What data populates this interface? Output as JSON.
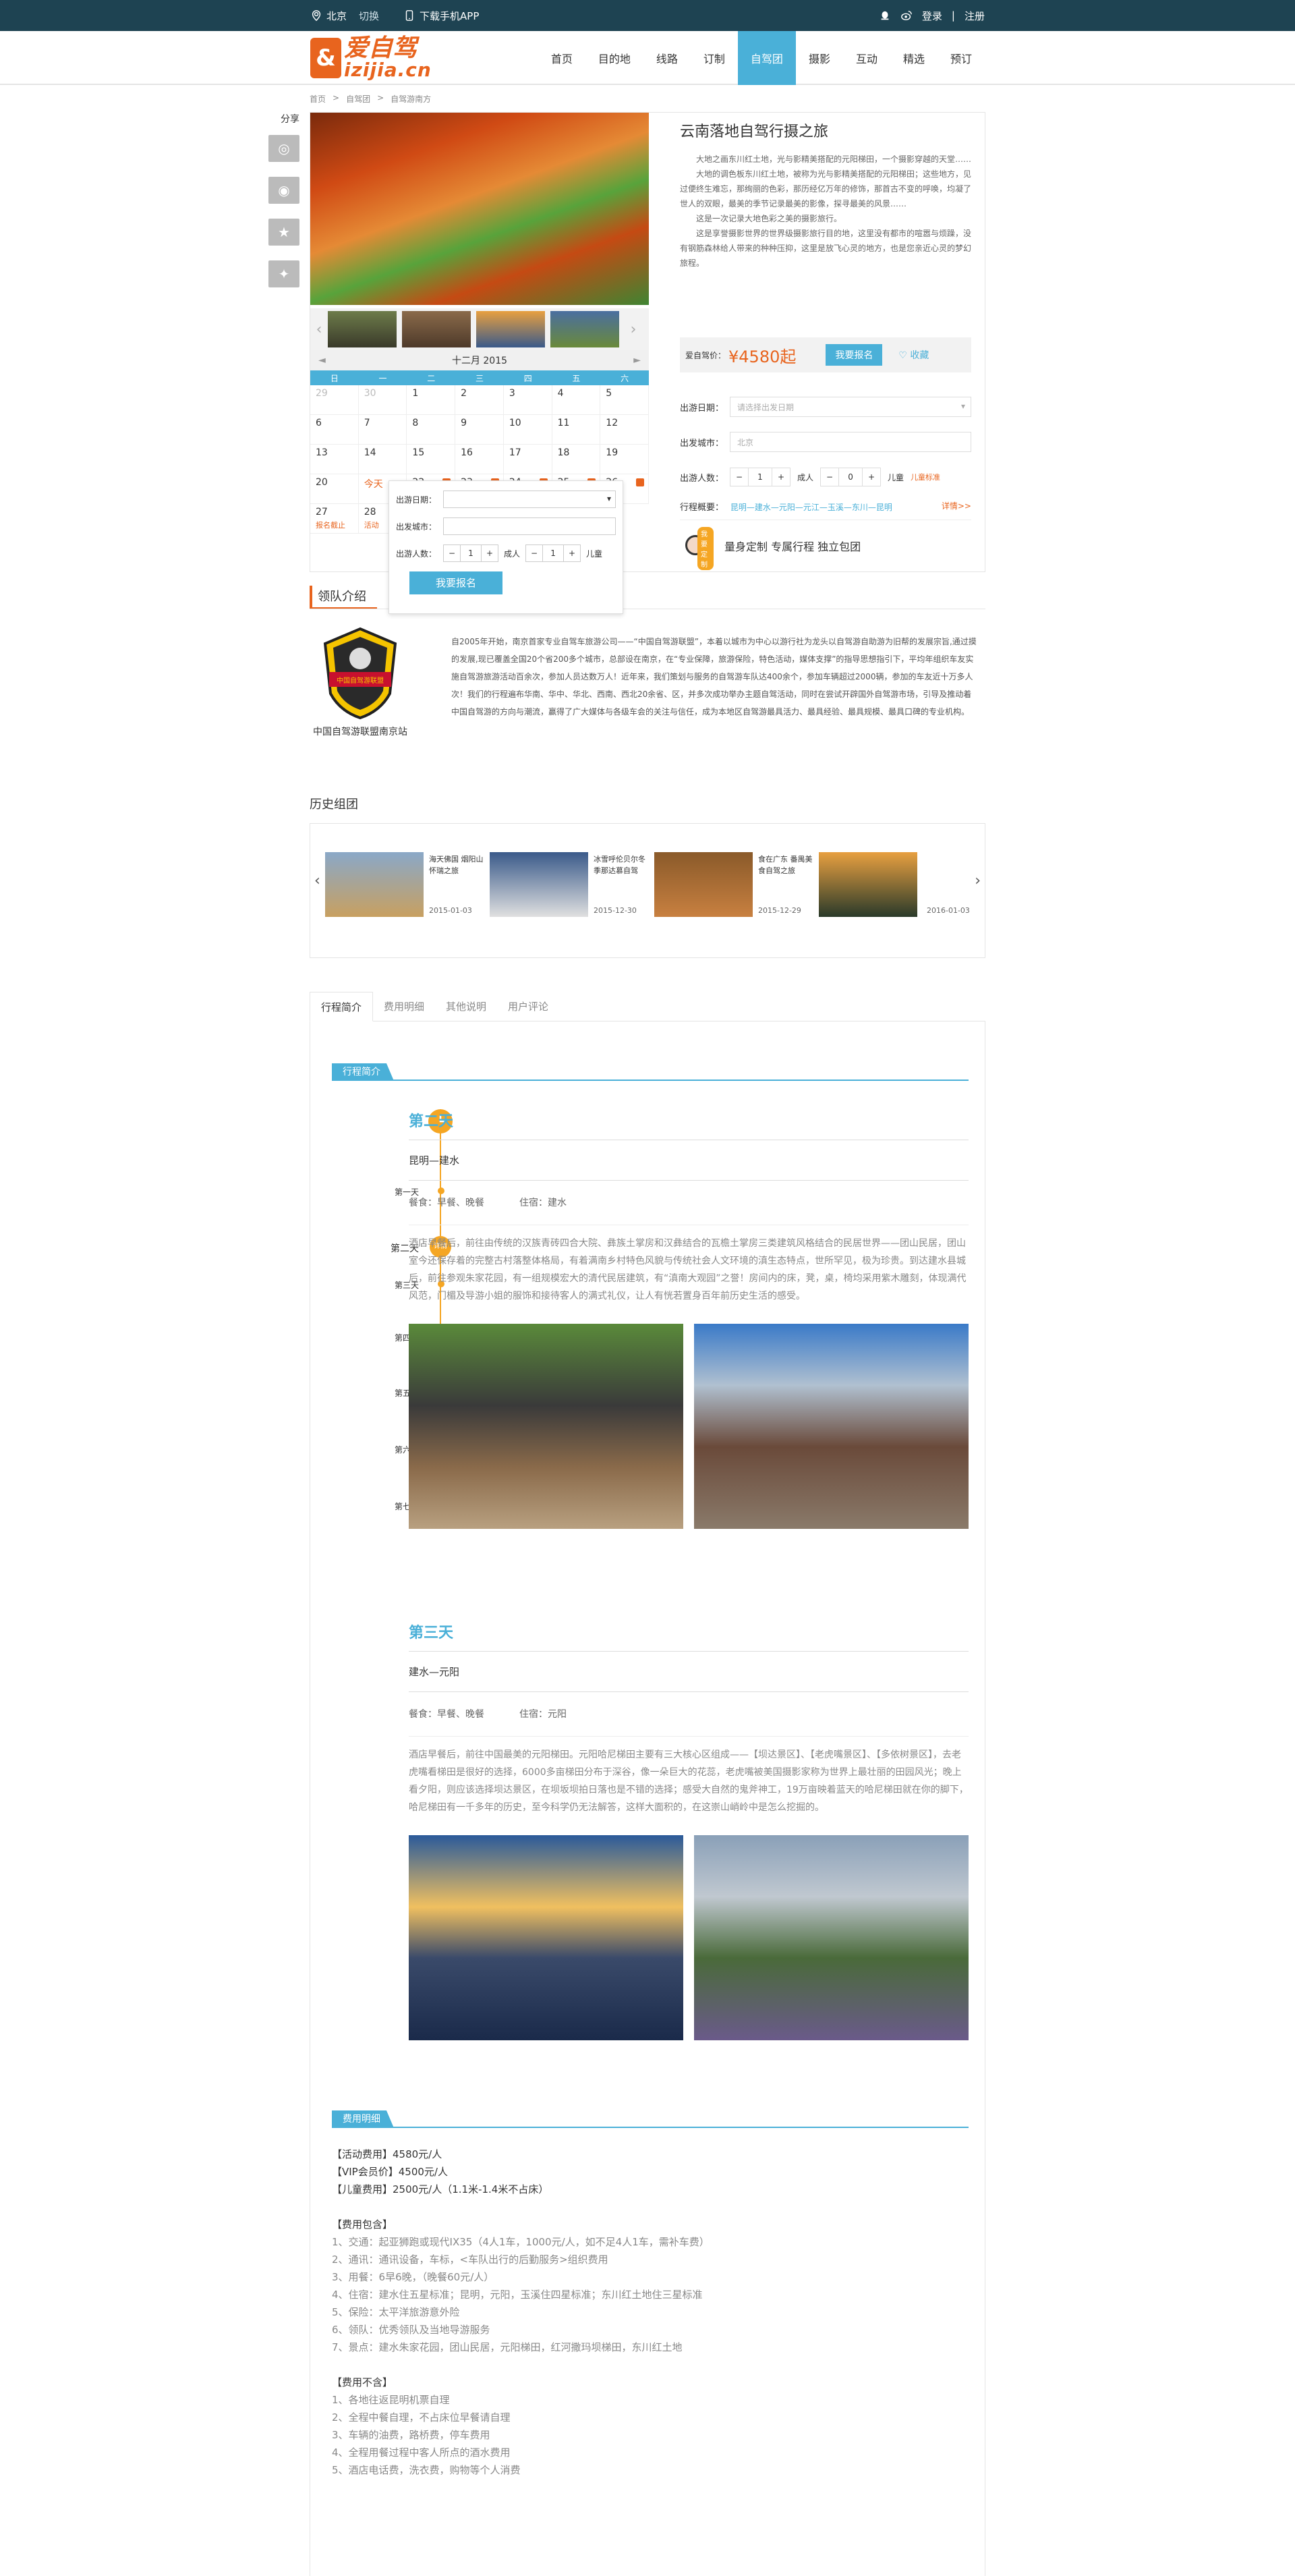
{
  "topbar": {
    "city": "北京",
    "switch": "切换",
    "app": "下载手机APP",
    "login": "登录",
    "divider": "|",
    "register": "注册"
  },
  "logo": {
    "mark": "&",
    "cn": "爱自驾",
    "en": "izijia.cn"
  },
  "nav": [
    "首页",
    "目的地",
    "线路",
    "订制",
    "自驾团",
    "摄影",
    "互动",
    "精选",
    "预订"
  ],
  "breadcrumb": [
    "首页",
    ">",
    "自驾团",
    ">",
    "自驾游南方"
  ],
  "share": {
    "label": "分享"
  },
  "product": {
    "title": "云南落地自驾行摄之旅",
    "desc": [
      "大地之画东川红土地，光与影精美搭配的元阳梯田，一个摄影穿越的天堂……",
      "大地的调色板东川红土地，被称为光与影精美搭配的元阳梯田；这些地方，见过便终生难忘，那绚丽的色彩，那历经亿万年的修饰，那首古不变的呼唤，均凝了世人的双眼，最美的季节记录最美的影像，探寻最美的风景……",
      "这是一次记录大地色彩之美的摄影旅行。",
      "这是享誉摄影世界的世界级摄影旅行目的地，这里没有都市的喧嚣与烦躁，没有钢筋森林给人带来的种种压抑，这里是放飞心灵的地方，也是您亲近心灵的梦幻旅程。"
    ],
    "price_label": "爱自驾价：",
    "price": "¥4580起",
    "signup": "我要报名",
    "favorite": "收藏",
    "form": {
      "date_label": "出游日期：",
      "date_ph": "请选择出发日期",
      "city_label": "出发城市：",
      "city_ph": "北京",
      "people_label": "出游人数：",
      "adult_num": "1",
      "adult": "成人",
      "child_num": "0",
      "child": "儿童",
      "child_note": "儿童标准"
    },
    "route_label": "行程概要：",
    "route": "昆明—建水—元阳—元江—玉溪—东川—昆明",
    "route_more": "详情>>",
    "custom_tag": "我要定制",
    "custom_text": "量身定制 专属行程 独立包团"
  },
  "calendar": {
    "title": "十二月  2015",
    "prev": "◄",
    "next": "►",
    "weekdays": [
      "日",
      "一",
      "二",
      "三",
      "四",
      "五",
      "六"
    ],
    "rows": [
      [
        "29",
        "30",
        "1",
        "2",
        "3",
        "4",
        "5"
      ],
      [
        "6",
        "7",
        "8",
        "9",
        "10",
        "11",
        "12"
      ],
      [
        "13",
        "14",
        "15",
        "16",
        "17",
        "18",
        "19"
      ],
      [
        "20",
        "今天",
        "22",
        "23",
        "24",
        "25",
        "26"
      ],
      [
        "27",
        "28",
        "",
        "",
        "",
        "",
        "",
        ""
      ]
    ],
    "notes": [
      "报名截止",
      "活动"
    ]
  },
  "popup": {
    "date_label": "出游日期：",
    "city_label": "出发城市：",
    "people_label": "出游人数：",
    "adult_num": "1",
    "adult": "成人",
    "child_num": "1",
    "child": "儿童",
    "btn": "我要报名"
  },
  "leader": {
    "heading": "领队介绍",
    "badge_text": "中国自驾游联盟",
    "name": "中国自驾游联盟南京站",
    "text": "自2005年开始，南京首家专业自驾车旅游公司——“中国自驾游联盟”，本着以城市为中心以游行社为龙头以自驾游自助游为旧帮的发展宗旨,通过摸的发展,现已覆盖全国20个省200多个城市，总部设在南京，在“专业保障，旅游保险，特色活动，媒体支撑”的指导思想指引下，平均年组织车友实施自驾游旅游活动百余次，参加人员达数万人！近年来，我们策划与服务的自驾游车队达400余个，参加车辆超过2000辆，参加的车友近十万多人次！我们的行程遍布华南、华中、华北、西南、西北20余省、区，并多次成功举办主题自驾活动，同时在尝试开辟国外自驾游市场，引导及推动着中国自驾游的方向与潮流，赢得了广大媒体与各级车会的关注与信任，成为本地区自驾游最具活力、最具经验、最具规模、最具口碑的专业机构。"
  },
  "history": {
    "heading": "历史组团",
    "items": [
      {
        "title": "海天佛国 烟阳山怀瑞之旅",
        "date": "2015-01-03"
      },
      {
        "title": "冰雪呼伦贝尔冬季那达慕自驾",
        "date": "2015-12-30"
      },
      {
        "title": "食在广东 番禺美食自驾之旅",
        "date": "2015-12-29"
      },
      {
        "title": "",
        "date": "2016-01-03"
      }
    ]
  },
  "tabs": [
    "行程简介",
    "费用明细",
    "其他说明",
    "用户评论"
  ],
  "itinerary": {
    "bar": "行程简介",
    "timeline": [
      "第一天",
      "第二天",
      "第三天",
      "第四天",
      "第五天",
      "第六天",
      "第七天"
    ],
    "current": "详情",
    "days": [
      {
        "title": "第二天",
        "route": "昆明—建水",
        "meal": "餐食：早餐、晚餐",
        "stay": "住宿：建水",
        "text": "酒店早餐后，前往由传统的汉族青砖四合大院、彝族土掌房和汉彝结合的瓦檐土掌房三类建筑风格结合的民居世界——团山民居，团山室今还保存着的完整古村落整体格局，有着满南乡村特色风貌与传统社会人文环境的滇生态特点，世所罕见，极为珍贵。到达建水县城后，前往参观朱家花园，有一组规模宏大的清代民居建筑，有“滇南大观园”之誉！房间内的床，凳，桌，椅均采用紫木雕刻，体现满代风范，门楣及导游小姐的服饰和接待客人的满式礼仪，让人有恍若置身百年前历史生活的感受。"
      },
      {
        "title": "第三天",
        "route": "建水—元阳",
        "meal": "餐食：早餐、晚餐",
        "stay": "住宿：元阳",
        "text": "酒店早餐后，前往中国最美的元阳梯田。元阳哈尼梯田主要有三大核心区组成——【坝达景区】、【老虎嘴景区】、【多依树景区】，去老虎嘴看梯田是很好的选择，6000多亩梯田分布于深谷，像一朵巨大的花蕊，老虎嘴被美国摄影家称为世界上最壮丽的田园风光；晚上看夕阳，则应该选择坝达景区，在坝坂坝拍日落也是不错的选择；感受大自然的鬼斧神工，19万亩映着蓝天的哈尼梯田就在你的脚下，哈尼梯田有一千多年的历史，至今科学仍无法解答，这样大面积的，在这崇山峭岭中是怎么挖掘的。"
      }
    ]
  },
  "fees": {
    "bar": "费用明细",
    "prices": [
      "【活动费用】4580元/人",
      "【VIP会员价】4500元/人",
      "【儿童费用】2500元/人（1.1米-1.4米不占床）"
    ],
    "include_h": "【费用包含】",
    "include": [
      "1、交通：起亚狮跑或现代IX35（4人1车，1000元/人，如不足4人1车，需补车费）",
      "2、通讯：通讯设备，车标，<车队出行的后勤服务>组织费用",
      "3、用餐：6早6晚，（晚餐60元/人）",
      "4、住宿：建水住五星标准；昆明，元阳，玉溪住四星标准；东川红土地住三星标准",
      "5、保险：太平洋旅游意外险",
      "6、领队：优秀领队及当地导游服务",
      "7、景点：建水朱家花园，团山民居，元阳梯田，红河撒玛坝梯田，东川红土地"
    ],
    "exclude_h": "【费用不含】",
    "exclude": [
      "1、各地往返昆明机票自理",
      "2、全程中餐自理，不占床位早餐请自理",
      "3、车辆的油费，路桥费，停车费用",
      "4、全程用餐过程中客人所点的酒水费用",
      "5、酒店电话费，洗衣费，购物等个人消费"
    ]
  },
  "colors": {
    "brand_orange": "#e8641e",
    "accent_blue": "#4ab0d8",
    "topbar": "#1e4352",
    "timeline": "#f5a623"
  }
}
